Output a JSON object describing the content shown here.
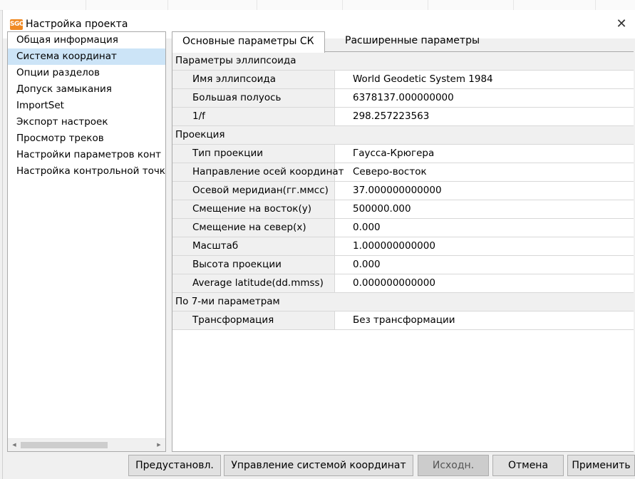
{
  "window": {
    "app_icon_text": "SGO",
    "title": "Настройка проекта",
    "close_glyph": "✕"
  },
  "sidebar": {
    "items": [
      {
        "label": "Общая информация",
        "selected": false
      },
      {
        "label": "Система координат",
        "selected": true
      },
      {
        "label": "Опции разделов",
        "selected": false
      },
      {
        "label": "Допуск замыкания",
        "selected": false
      },
      {
        "label": "ImportSet",
        "selected": false
      },
      {
        "label": "Экспорт настроек",
        "selected": false
      },
      {
        "label": "Просмотр треков",
        "selected": false
      },
      {
        "label": "Настройки параметров конт",
        "selected": false
      },
      {
        "label": "Настройка контрольной точк",
        "selected": false
      }
    ],
    "scroll_left": "◀",
    "scroll_right": "▶"
  },
  "tabs": [
    {
      "label": "Основные параметры СК",
      "active": true
    },
    {
      "label": "Расширенные параметры",
      "active": false
    }
  ],
  "properties": {
    "ellipsoid_group": "Параметры эллипсоида",
    "ellipsoid_rows": [
      {
        "name": "Имя эллипсоида",
        "value": "World Geodetic System 1984"
      },
      {
        "name": "Большая полуось",
        "value": "6378137.000000000"
      },
      {
        "name": "1/f",
        "value": "298.257223563"
      }
    ],
    "projection_group": "Проекция",
    "projection_rows": [
      {
        "name": "Тип проекции",
        "value": "Гаусса-Крюгера"
      },
      {
        "name": "Направление осей координат",
        "value": "Северо-восток"
      },
      {
        "name": "Осевой меридиан(гг.ммсс)",
        "value": "37.000000000000"
      },
      {
        "name": "Смещение на восток(y)",
        "value": "500000.000"
      },
      {
        "name": "Смещение на север(x)",
        "value": "0.000"
      },
      {
        "name": "Масштаб",
        "value": "1.000000000000"
      },
      {
        "name": "Высота проекции",
        "value": "0.000"
      },
      {
        "name": "Average latitude(dd.mmss)",
        "value": "0.000000000000"
      }
    ],
    "seven_param_group": "По 7-ми параметрам",
    "seven_param_rows": [
      {
        "name": "Трансформация",
        "value": "Без трансформации"
      }
    ]
  },
  "buttons": {
    "preset": "Предустановл.",
    "manage_cs": "Управление системой координат",
    "default": "Исходн.",
    "cancel": "Отмена",
    "apply": "Применить"
  },
  "colors": {
    "selected_item": "#cce4f7",
    "app_icon": "#f08a24"
  }
}
